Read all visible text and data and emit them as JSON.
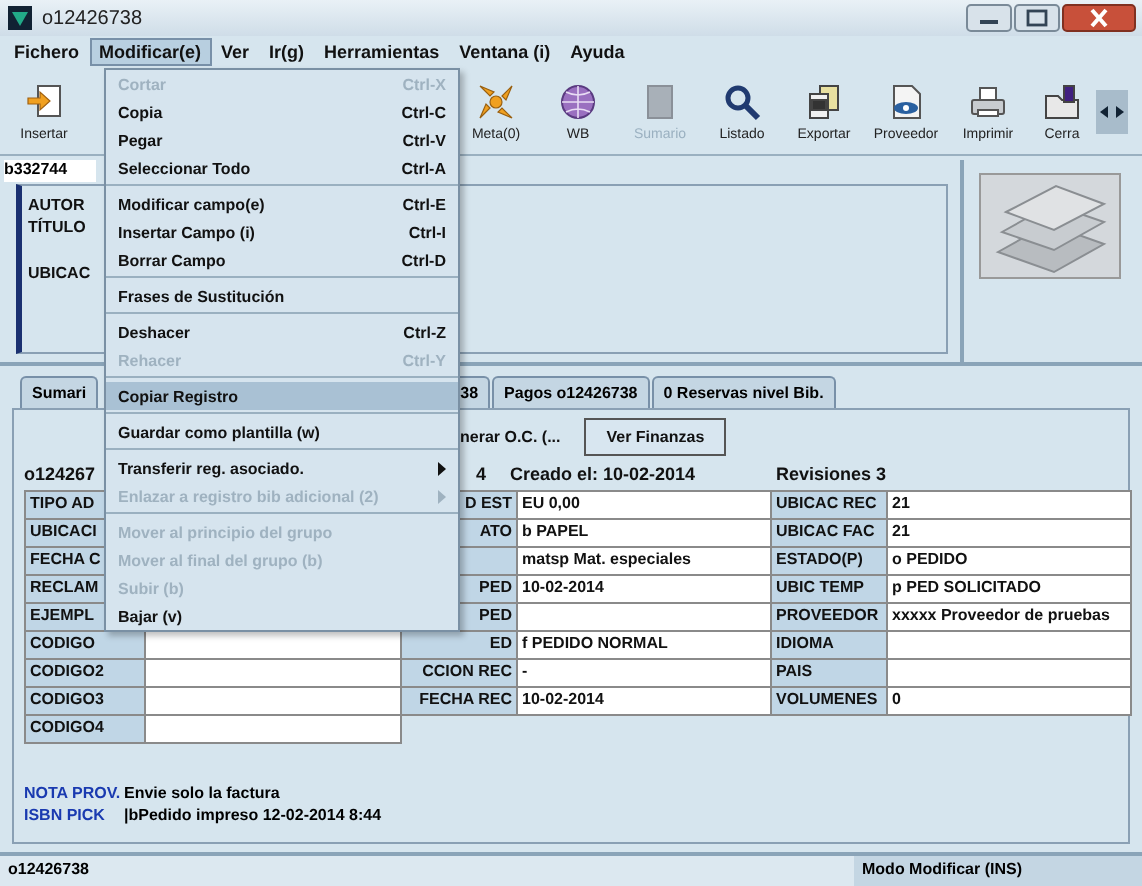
{
  "window": {
    "title": "o12426738"
  },
  "menu_bar": [
    {
      "label": "Fichero",
      "selected": false
    },
    {
      "label": "Modificar(e)",
      "selected": true
    },
    {
      "label": "Ver",
      "selected": false
    },
    {
      "label": "Ir(g)",
      "selected": false
    },
    {
      "label": "Herramientas",
      "selected": false
    },
    {
      "label": "Ventana (i)",
      "selected": false
    },
    {
      "label": "Ayuda",
      "selected": false
    }
  ],
  "toolbar": [
    {
      "kind": "insert",
      "label": "Insertar",
      "disabled": false
    },
    {
      "kind": "meta",
      "label": "Meta(0)",
      "disabled": false
    },
    {
      "kind": "web",
      "label": "WB",
      "disabled": false
    },
    {
      "kind": "summary",
      "label": "Sumario",
      "disabled": true
    },
    {
      "kind": "search",
      "label": "Listado",
      "disabled": false
    },
    {
      "kind": "export",
      "label": "Exportar",
      "disabled": false
    },
    {
      "kind": "vendor",
      "label": "Proveedor",
      "disabled": false
    },
    {
      "kind": "print",
      "label": "Imprimir",
      "disabled": false
    },
    {
      "kind": "folder",
      "label": "Cerra",
      "disabled": false
    }
  ],
  "record": {
    "id": "b332744",
    "fields": [
      {
        "label": "AUTOR"
      },
      {
        "label": "TÍTULO"
      },
      {
        "label": "UBICAC"
      }
    ]
  },
  "tabs": [
    {
      "label": "Sumari",
      "selected": false
    },
    {
      "label": "38",
      "selected": false
    },
    {
      "label": "Pagos o12426738",
      "selected": false
    },
    {
      "label": "0 Reservas nivel Bib.",
      "selected": false
    }
  ],
  "actions": [
    {
      "kind": "plain",
      "label": "nerar O.C. (..."
    },
    {
      "kind": "outlined",
      "label": "Ver Finanzas"
    }
  ],
  "header": {
    "id": "o124267",
    "id_tail": "4",
    "created": "Creado el: 10-02-2014",
    "revisions": "Revisiones 3"
  },
  "table": {
    "rows": [
      {
        "pairs": [
          {
            "label": "TIPO AD"
          },
          {
            "label": "D EST",
            "value": "EU 0,00"
          },
          {
            "label": "UBICAC REC",
            "value": "21"
          }
        ]
      },
      {
        "pairs": [
          {
            "label": "UBICACI"
          },
          {
            "label": "ATO",
            "value": "b  PAPEL"
          },
          {
            "label": "UBICAC FAC",
            "value": "21"
          }
        ]
      },
      {
        "pairs": [
          {
            "label": "FECHA C"
          },
          {
            "value": "matsp  Mat. especiales"
          },
          {
            "label": "ESTADO(P)",
            "value": "o  PEDIDO"
          }
        ]
      },
      {
        "pairs": [
          {
            "label": "RECLAM"
          },
          {
            "label": "PED",
            "value": "10-02-2014"
          },
          {
            "label": "UBIC TEMP",
            "value": "p  PED SOLICITADO"
          }
        ]
      },
      {
        "pairs": [
          {
            "label": "EJEMPL"
          },
          {
            "label": "PED"
          },
          {
            "label": "PROVEEDOR",
            "value": "xxxxx  Proveedor de pruebas"
          }
        ]
      },
      {
        "pairs": [
          {
            "label": "CODIGO"
          },
          {
            "label": "ED",
            "value": "f  PEDIDO NORMAL"
          },
          {
            "label": "IDIOMA"
          }
        ]
      },
      {
        "pairs": [
          {
            "label": "CODIGO2"
          },
          {
            "label": "CCION REC",
            "value": "-"
          },
          {
            "label": "PAIS"
          }
        ]
      },
      {
        "pairs": [
          {
            "label": "CODIGO3"
          },
          {
            "label": "FECHA REC",
            "value": "10-02-2014"
          },
          {
            "label": "VOLUMENES",
            "value": "0"
          }
        ]
      },
      {
        "pairs": [
          {
            "label": "CODIGO4"
          }
        ]
      }
    ]
  },
  "notes": [
    {
      "label": "NOTA PROV.",
      "value": "Envie solo la factura"
    },
    {
      "label": "ISBN PICK",
      "value": "|bPedido impreso 12-02-2014 8:44"
    }
  ],
  "status_bar": {
    "left": "o12426738",
    "mode": "Modo Modificar (INS)"
  },
  "edit_menu": {
    "items": [
      {
        "kind": "item",
        "label": "Cortar",
        "shortcut": "Ctrl-X",
        "disabled": true,
        "selected": false
      },
      {
        "kind": "item",
        "label": "Copia",
        "shortcut": "Ctrl-C",
        "disabled": false,
        "selected": false
      },
      {
        "kind": "item",
        "label": "Pegar",
        "shortcut": "Ctrl-V",
        "disabled": false,
        "selected": false
      },
      {
        "kind": "item",
        "label": "Seleccionar Todo",
        "shortcut": "Ctrl-A",
        "disabled": false,
        "selected": false
      },
      {
        "kind": "separator"
      },
      {
        "kind": "item",
        "label": "Modificar campo(e)",
        "shortcut": "Ctrl-E",
        "disabled": false,
        "selected": false
      },
      {
        "kind": "item",
        "label": "Insertar Campo (i)",
        "shortcut": "Ctrl-I",
        "disabled": false,
        "selected": false
      },
      {
        "kind": "item",
        "label": "Borrar Campo",
        "shortcut": "Ctrl-D",
        "disabled": false,
        "selected": false
      },
      {
        "kind": "separator"
      },
      {
        "kind": "item",
        "label": "Frases de Sustitución",
        "disabled": false,
        "selected": false
      },
      {
        "kind": "separator"
      },
      {
        "kind": "item",
        "label": "Deshacer",
        "shortcut": "Ctrl-Z",
        "disabled": false,
        "selected": false
      },
      {
        "kind": "item",
        "label": "Rehacer",
        "shortcut": "Ctrl-Y",
        "disabled": true,
        "selected": false
      },
      {
        "kind": "separator"
      },
      {
        "kind": "item",
        "label": "Copiar Registro",
        "disabled": false,
        "selected": true
      },
      {
        "kind": "separator"
      },
      {
        "kind": "item",
        "label": "Guardar como plantilla (w)",
        "disabled": false,
        "selected": false
      },
      {
        "kind": "separator"
      },
      {
        "kind": "submenu",
        "label": "Transferir reg. asociado.",
        "disabled": false,
        "selected": false
      },
      {
        "kind": "submenu",
        "label": "Enlazar a registro bib adicional (2)",
        "disabled": true,
        "selected": false
      },
      {
        "kind": "separator"
      },
      {
        "kind": "item",
        "label": "Mover al principio del grupo",
        "disabled": true,
        "selected": false
      },
      {
        "kind": "item",
        "label": "Mover al final del grupo (b)",
        "disabled": true,
        "selected": false
      },
      {
        "kind": "item",
        "label": "Subir (b)",
        "disabled": true,
        "selected": false
      },
      {
        "kind": "item",
        "label": "Bajar (v)",
        "disabled": false,
        "selected": false
      }
    ]
  }
}
